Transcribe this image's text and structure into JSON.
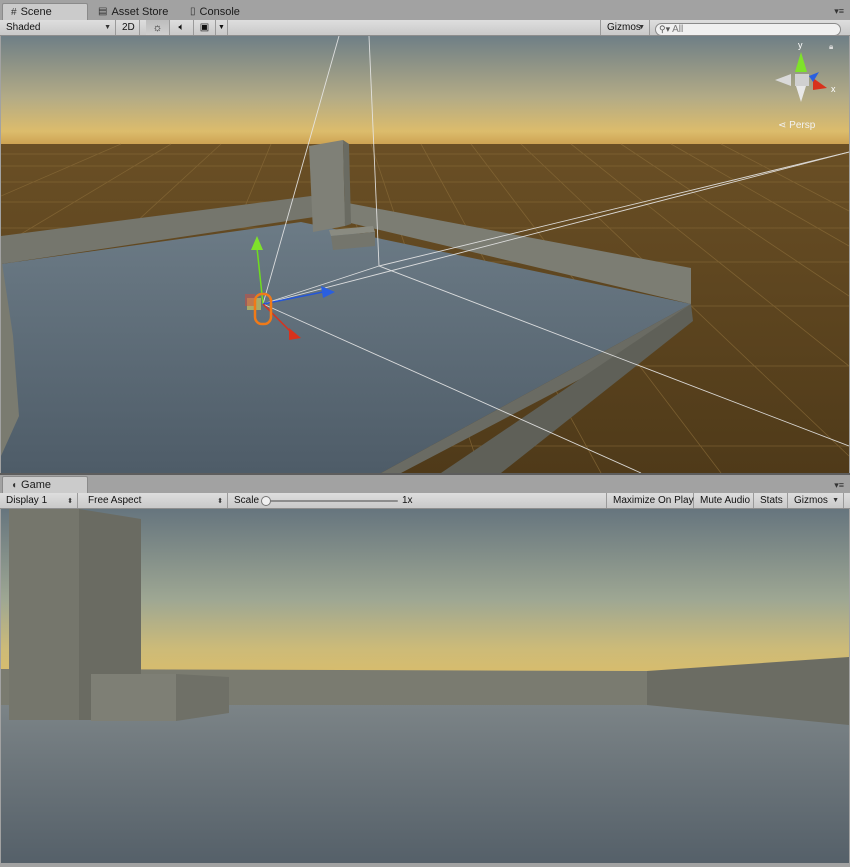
{
  "scene_tabs": [
    {
      "label": "Scene",
      "icon": "grid-icon",
      "active": true
    },
    {
      "label": "Asset Store",
      "icon": "bag-icon",
      "active": false
    },
    {
      "label": "Console",
      "icon": "console-icon",
      "active": false
    }
  ],
  "scene_toolbar": {
    "shading_mode": "Shaded",
    "mode_2d": "2D",
    "gizmos_label": "Gizmos",
    "search_placeholder": "All"
  },
  "scene_view": {
    "projection_label": "Persp",
    "axis_labels": {
      "x": "x",
      "y": "y"
    }
  },
  "game_tab": {
    "label": "Game",
    "icon": "pacman-icon"
  },
  "game_toolbar": {
    "display": "Display 1",
    "aspect": "Free Aspect",
    "scale_label": "Scale",
    "scale_value": "1x",
    "maximize_on_play": "Maximize On Play",
    "mute_audio": "Mute Audio",
    "stats": "Stats",
    "gizmos_label": "Gizmos"
  },
  "colors": {
    "panel_bg": "#a2a2a2",
    "sky_top": "#6f7f88",
    "horizon": "#d6b86a",
    "ground": "#5a4420",
    "platform": "#5b6b78",
    "wall": "#6e6f66",
    "axis_x": "#d8321c",
    "axis_y": "#6fdc1e",
    "axis_z": "#2456d8",
    "selection": "#f07a18"
  }
}
